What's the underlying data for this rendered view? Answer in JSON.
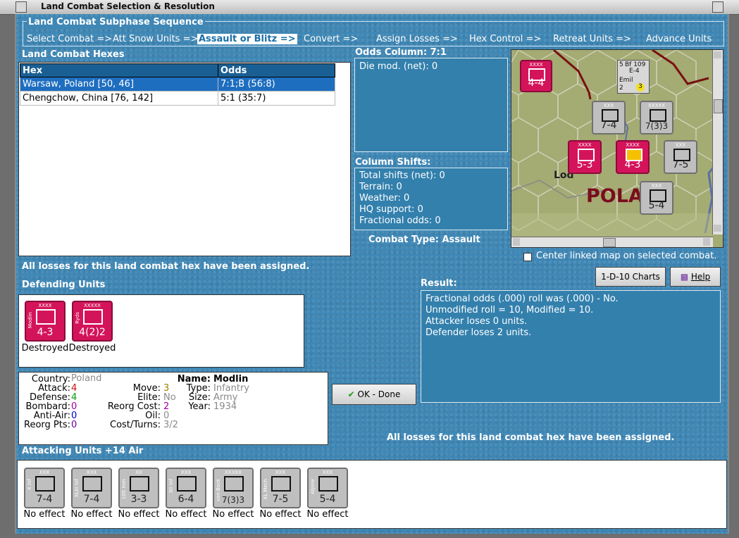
{
  "window": {
    "title": "Land Combat Selection & Resolution"
  },
  "sequence": {
    "title": "Land Combat Subphase Sequence",
    "steps": [
      "Select Combat =>",
      "Att Snow Units =>",
      "Assault or Blitz =>",
      "Convert =>",
      "Assign Losses =>",
      "Hex Control =>",
      "Retreat Units =>",
      "Advance Units"
    ],
    "active_step": "Assault or Blitz =>"
  },
  "hexes": {
    "title": "Land Combat Hexes",
    "columns": [
      "Hex",
      "Odds"
    ],
    "rows": [
      {
        "hex": "Warsaw, Poland [50, 46]",
        "odds": "7:1;B (56:8)",
        "selected": true
      },
      {
        "hex": "Chengchow, China [76, 142]",
        "odds": "5:1 (35:7)",
        "selected": false
      }
    ]
  },
  "odds": {
    "title": "Odds Column: 7:1",
    "lines": [
      "Die mod. (net): 0"
    ]
  },
  "shifts": {
    "title": "Column Shifts:",
    "lines": [
      "Total shifts (net): 0",
      "Terrain: 0",
      "Weather: 0",
      "HQ support: 0",
      "Fractional odds: 0"
    ]
  },
  "combat_type": "Combat Type:  Assault",
  "map": {
    "label_poland": "POLA",
    "label_lodz": "Lod",
    "center_checkbox_label": "Center linked map on selected combat.",
    "counters": [
      {
        "value": "4-4",
        "color": "pink",
        "size": "XXXX"
      },
      {
        "value": "7-4",
        "color": "gray",
        "size": "XXX"
      },
      {
        "value": "7(3)3",
        "color": "gray",
        "size": "XXXXX"
      },
      {
        "value": "5-3",
        "color": "pink",
        "size": "XXXX"
      },
      {
        "value": "4-3",
        "color": "pink",
        "size": "XXXX"
      },
      {
        "value": "7-5",
        "color": "gray",
        "size": "XXX"
      },
      {
        "value": "5-4",
        "color": "gray",
        "size": "XXX"
      }
    ],
    "air": {
      "bf_label": "Bf 109",
      "e4": "E-4",
      "top": "5",
      "left": "2",
      "right": "3",
      "name": "Emil"
    }
  },
  "messages": {
    "losses_assigned": "All losses for this land combat hex have been assigned."
  },
  "defending": {
    "title": "Defending Units",
    "units": [
      {
        "size": "XXXX",
        "name": "Modlin",
        "side": "POL",
        "value": "4-3",
        "status": "Destroyed"
      },
      {
        "size": "XXXXX",
        "name": "Ryds",
        "side": "POL",
        "value": "4(2)2",
        "status": "Destroyed"
      }
    ]
  },
  "unit_info": {
    "country_label": "Country:",
    "country": "Poland",
    "attack_label": "Attack:",
    "attack": "4",
    "defense_label": "Defense:",
    "defense": "4",
    "bombard_label": "Bombard:",
    "bombard": "0",
    "antiair_label": "Anti-Air:",
    "antiair": "0",
    "reorg_pts_label": "Reorg Pts:",
    "reorg_pts": "0",
    "move_label": "Move:",
    "move": "3",
    "elite_label": "Elite:",
    "elite": "No",
    "reorg_cost_label": "Reorg Cost:",
    "reorg_cost": "2",
    "oil_label": "Oil:",
    "oil": "0",
    "cost_turns_label": "Cost/Turns:",
    "cost_turns": "3/2",
    "name_label": "Name:",
    "name": "Modlin",
    "type_label": "Type:",
    "type": "Infantry",
    "size_label": "Size:",
    "size": "Army",
    "year_label": "Year:",
    "year": "1934",
    "colors": {
      "country": "#8a8a8a",
      "attack": "#d01010",
      "defense": "#00a000",
      "bombard": "#a000a0",
      "antiair": "#0000d0",
      "reorg": "#6a00a0",
      "move": "#a08000",
      "cost": "#a000a0"
    }
  },
  "buttons": {
    "charts": "1-D-10 Charts",
    "help": "Help",
    "ok": "OK - Done"
  },
  "result": {
    "title": "Result:",
    "lines": [
      "Fractional odds (.000) roll was (.000)  - No.",
      "Unmodified roll = 10, Modified = 10.",
      "Attacker loses 0 units.",
      "Defender loses 2 units."
    ]
  },
  "attacking": {
    "title": "Attacking Units +14 Air",
    "units": [
      {
        "size": "XXX",
        "name": "X Inf",
        "value": "7-4",
        "status": "No effect"
      },
      {
        "size": "XXX",
        "name": "XLIII Inf",
        "value": "7-4",
        "status": "No effect"
      },
      {
        "size": "XX",
        "name": "105 mm",
        "value": "3-3",
        "status": "No effect"
      },
      {
        "size": "XXX",
        "name": "XII Inf",
        "value": "6-4",
        "status": "No effect"
      },
      {
        "size": "XXXXX",
        "name": "von Bock",
        "value": "7(3)3",
        "status": "No effect"
      },
      {
        "size": "XXX",
        "name": "XL Mech",
        "value": "7-5",
        "status": "No effect"
      },
      {
        "size": "XXX",
        "name": "Alpine",
        "value": "5-4",
        "status": "No effect"
      }
    ]
  }
}
